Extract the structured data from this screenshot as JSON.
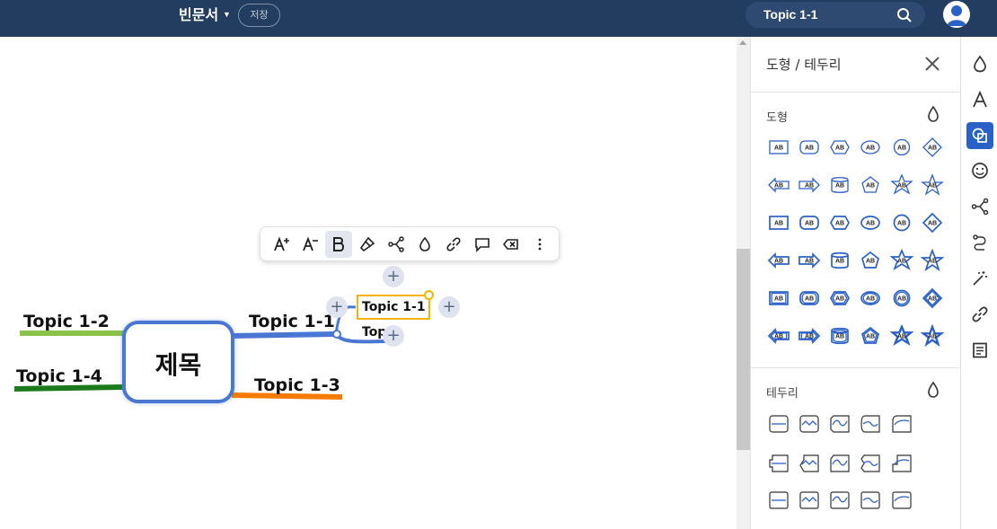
{
  "topbar": {
    "doc_title": "빈문서",
    "save_label": "저장",
    "search_value": "Topic 1-1"
  },
  "mindmap": {
    "central_topic": "제목",
    "topics": [
      {
        "id": "t12",
        "label": "Topic 1-2",
        "color": "#8bc34a"
      },
      {
        "id": "t14",
        "label": "Topic 1-4",
        "color": "#1b7a1b"
      },
      {
        "id": "t11",
        "label": "Topic 1-1",
        "color": "#4a77d4"
      },
      {
        "id": "t13",
        "label": "Topic 1-3",
        "color": "#f57c00"
      }
    ],
    "selected_topic": "Topic 1-1",
    "truncated_child": "Top",
    "plus_symbol": "+"
  },
  "floating_toolbar": {
    "tools": [
      {
        "name": "font-increase",
        "icon": "font-increase-icon"
      },
      {
        "name": "font-decrease",
        "icon": "font-decrease-icon"
      },
      {
        "name": "bold",
        "icon": "bold-icon",
        "active": true
      },
      {
        "name": "format-paint",
        "icon": "brush-icon"
      },
      {
        "name": "connect",
        "icon": "connect-icon"
      },
      {
        "name": "color",
        "icon": "droplet-icon"
      },
      {
        "name": "link",
        "icon": "link-icon"
      },
      {
        "name": "comment",
        "icon": "comment-icon"
      },
      {
        "name": "delete",
        "icon": "delete-icon"
      },
      {
        "name": "more",
        "icon": "more-vertical-icon"
      }
    ]
  },
  "side_panel": {
    "title": "도형 / 테두리",
    "shape_section": "도형",
    "border_section": "테두리",
    "shape_label": "AB",
    "shape_color": "#2a61c7"
  },
  "right_rail": {
    "items": [
      "droplet-icon",
      "font-icon",
      "shapes-icon",
      "emoji-icon",
      "branch-icon",
      "undo-path-icon",
      "magic-wand-icon",
      "link-icon",
      "notes-icon"
    ],
    "active": "shapes-icon"
  },
  "colors": {
    "topbar_bg": "#233d61",
    "accent": "#2a61c7",
    "selection": "#f5b400"
  }
}
